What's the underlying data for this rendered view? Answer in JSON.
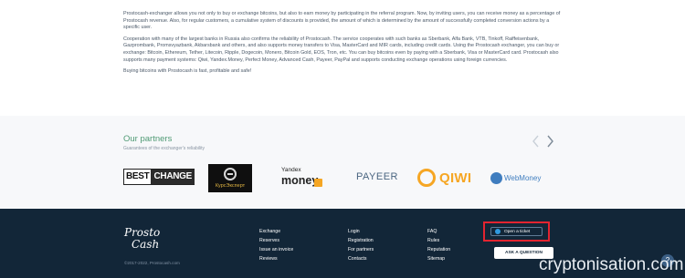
{
  "intro": {
    "p1": "Prostocash-exchanger allows you not only to buy or exchange bitcoins, but also to earn money by participating in the referral program. Now, by inviting users, you can receive money as a percentage of Prostocash revenue. Also, for regular customers, a cumulative system of discounts is provided, the amount of which is determined by the amount of successfully completed conversion actions by a specific user.",
    "p2": "Cooperation with many of the largest banks in Russia also confirms the reliability of Prostocash. The service cooperates with such banks as Sberbank, Alfa Bank, VTB, Tinkoff, Raiffeisenbank, Gazprombank, Promsvyazbank, Akbarsbank and others, and also supports money transfers to Visa, MasterCard and MIR cards, including credit cards. Using the Prostocash exchanger, you can buy or exchange: Bitcoin, Ethereum, Tether, Litecoin, Ripple, Dogecoin, Monero, Bitcoin Gold, EOS, Tron, etc. You can buy bitcoins even by paying with a Sberbank, Visa or MasterCard card. Prostocash also supports many payment systems: Qiwi, Yandex.Money, Perfect Money, Advanced Cash, Payeer, PayPal and supports conducting exchange operations using foreign currencies.",
    "p3": "Buying bitcoins with Prostocash is fast, profitable and safe!"
  },
  "partners": {
    "title": "Our partners",
    "subtitle": "Guarantees of the exchanger's reliability",
    "logos": {
      "bestchange_a": "BEST",
      "bestchange_b": "CHANGE",
      "kurs": "КурсЭксперт",
      "yandex_top": "Yandex",
      "yandex_bottom": "money",
      "payeer": "PAYEER",
      "qiwi": "QIWI",
      "webmoney": "WebMoney"
    }
  },
  "footer": {
    "logo_line1": "Prosto",
    "logo_line2": "Cash",
    "copyright": "©2017-2022, Prostocash.com",
    "col1": [
      "Exchange",
      "Reserves",
      "Issue an invoice",
      "Reviews"
    ],
    "col2": [
      "Login",
      "Registration",
      "For partners",
      "Contacts"
    ],
    "col3": [
      "FAQ",
      "Rules",
      "Reputation",
      "Sitemap"
    ],
    "open_ticket": "Open a ticket",
    "ask_question": "ASK A QUESTION",
    "help_symbol": "?"
  },
  "watermark": "cryptonisation.com",
  "colors": {
    "accent_green": "#4f9a74",
    "footer_bg": "#122638",
    "highlight_red": "#e32430"
  },
  "icons": {
    "prev": "chevron-left-icon",
    "next": "chevron-right-icon",
    "telegram": "telegram-icon",
    "help": "help-icon"
  }
}
